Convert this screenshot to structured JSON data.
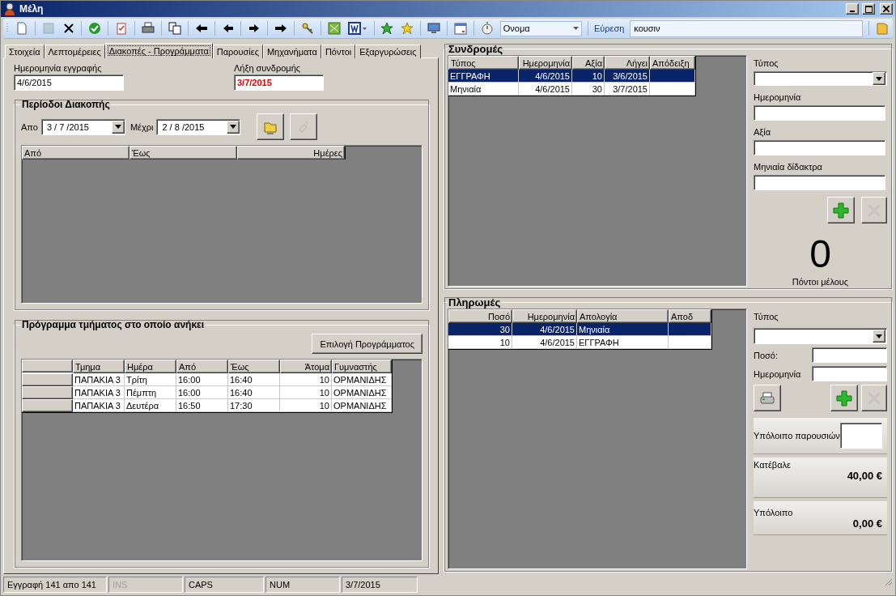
{
  "window": {
    "title": "Μέλη"
  },
  "toolbar": {
    "items": [
      {
        "kind": "new",
        "disabled": false
      },
      {
        "kind": "save",
        "disabled": true
      },
      {
        "kind": "delete",
        "disabled": false
      },
      {
        "kind": "confirm",
        "disabled": false
      },
      {
        "kind": "clipboard",
        "disabled": false
      },
      {
        "kind": "print",
        "disabled": false
      },
      {
        "kind": "copy",
        "disabled": false
      },
      {
        "kind": "first",
        "disabled": false
      },
      {
        "kind": "previous",
        "disabled": false
      },
      {
        "kind": "next",
        "disabled": false
      },
      {
        "kind": "last",
        "disabled": false
      },
      {
        "kind": "keys",
        "disabled": false
      },
      {
        "kind": "excel",
        "disabled": false
      },
      {
        "kind": "word",
        "disabled": false
      },
      {
        "kind": "star-green",
        "disabled": false
      },
      {
        "kind": "star-yellow",
        "disabled": false
      },
      {
        "kind": "monitor",
        "disabled": false
      },
      {
        "kind": "calendar",
        "disabled": false
      },
      {
        "kind": "stopwatch",
        "disabled": false
      }
    ],
    "field_select": "Ονομα",
    "search_label": "Εύρεση",
    "search_value": "κουσιν"
  },
  "tabs": [
    {
      "label": "Στοιχεία",
      "selected": false
    },
    {
      "label": "Λεπτομέρειες",
      "selected": false
    },
    {
      "label": "Διακοπές - Προγράμματα",
      "selected": true
    },
    {
      "label": "Παρουσίες",
      "selected": false
    },
    {
      "label": "Μηχανήματα",
      "selected": false
    },
    {
      "label": "Πόντοι",
      "selected": false
    },
    {
      "label": "Εξαργυρώσεις",
      "selected": false
    }
  ],
  "registration": {
    "label": "Ημερομηνία εγγραφής",
    "value": "4/6/2015"
  },
  "expiry": {
    "label": "Λήξη συνδρομής",
    "value": "3/7/2015"
  },
  "vacation": {
    "title": "Περίοδοι Διακοπής",
    "from_label": "Απο",
    "from_value": "3 / 7 /2015",
    "to_label": "Μέχρι",
    "to_value": "2 / 8 /2015",
    "buttons": [
      {
        "kind": "add",
        "disabled": false
      },
      {
        "kind": "clear",
        "disabled": true
      }
    ],
    "columns": [
      "Από",
      "Έως",
      "Ημέρες"
    ]
  },
  "schedule": {
    "title": "Πρόγραμμα τμήματος στο οποίο ανήκει",
    "button": "Επιλογή Προγράμματος",
    "columns": [
      "Τμημα",
      "Ημέρα",
      "Από",
      "Έως",
      "Άτομα",
      "Γυμναστής"
    ],
    "rows": [
      {
        "cells": [
          "ΠΑΠΑΚΙΑ 3",
          "Τρίτη",
          "16:00",
          "16:40",
          "10",
          "ΟΡΜΑΝΙΔΗΣ"
        ]
      },
      {
        "cells": [
          "ΠΑΠΑΚΙΑ 3",
          "Πέμπτη",
          "16:00",
          "16:40",
          "10",
          "ΟΡΜΑΝΙΔΗΣ"
        ]
      },
      {
        "cells": [
          "ΠΑΠΑΚΙΑ 3",
          "Δευτέρα",
          "16:50",
          "17:30",
          "10",
          "ΟΡΜΑΝΙΔΗΣ"
        ]
      }
    ]
  },
  "subscriptions": {
    "title": "Συνδρομές",
    "columns": [
      "Τύπος",
      "Ημερομηνία",
      "Αξία",
      "Λήγει",
      "Απόδειξη"
    ],
    "rows": [
      {
        "cells": [
          "ΕΓΓΡΑΦΗ",
          "4/6/2015",
          "10",
          "3/6/2015",
          ""
        ],
        "selected": true
      },
      {
        "cells": [
          "Μηνιαία",
          "4/6/2015",
          "30",
          "3/7/2015",
          ""
        ],
        "selected": false
      }
    ],
    "fields": [
      {
        "label": "Τύπος",
        "kind": "select"
      },
      {
        "label": "Ημερομηνία",
        "kind": "text"
      },
      {
        "label": "Αξία",
        "kind": "text"
      },
      {
        "label": "Μηνιαία δίδακτρα",
        "kind": "text"
      }
    ],
    "buttons": [
      {
        "kind": "add",
        "disabled": false
      },
      {
        "kind": "delete",
        "disabled": true
      }
    ],
    "points": "0",
    "points_label": "Πόντοι μέλους"
  },
  "payments": {
    "title": "Πληρωμές",
    "columns": [
      "Ποσό",
      "Ημερομηνία",
      "Απολογία",
      "Αποδ"
    ],
    "rows": [
      {
        "cells": [
          "30",
          "4/6/2015",
          "Μηνιαία",
          ""
        ],
        "selected": true
      },
      {
        "cells": [
          "10",
          "4/6/2015",
          "ΕΓΓΡΑΦΗ",
          ""
        ],
        "selected": false
      }
    ],
    "type_label": "Τύπος",
    "amount_label": "Ποσό:",
    "date_label": "Ημερομηνία",
    "buttons": [
      {
        "kind": "print",
        "disabled": false
      },
      {
        "kind": "add",
        "disabled": false
      },
      {
        "kind": "delete",
        "disabled": true
      }
    ],
    "visits_label": "Υπόλοιπο παρουσιών",
    "paid_label": "Κατέβαλε",
    "paid_value": "40,00 €",
    "balance_label": "Υπόλοιπο",
    "balance_value": "0,00 €"
  },
  "status_bar": [
    {
      "text": "Εγγραφή 141 απο 141",
      "disabled": false
    },
    {
      "text": "INS",
      "disabled": true
    },
    {
      "text": "CAPS",
      "disabled": false
    },
    {
      "text": "NUM",
      "disabled": false
    },
    {
      "text": "3/7/2015",
      "disabled": false
    }
  ]
}
